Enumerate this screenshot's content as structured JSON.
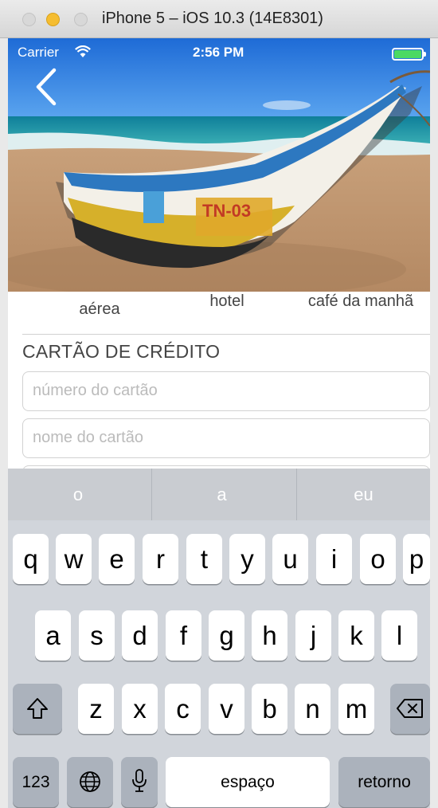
{
  "window": {
    "title": "iPhone 5 – iOS 10.3 (14E8301)"
  },
  "status_bar": {
    "carrier": "Carrier",
    "time": "2:56 PM",
    "battery_color": "#4cd964"
  },
  "nav": {
    "back_icon": "chevron-left-icon"
  },
  "hero": {
    "icon": "beach-boat-photo",
    "boat_text": "TN-03"
  },
  "features": {
    "items": [
      {
        "label": "aérea"
      },
      {
        "label": "hotel"
      },
      {
        "label": "café da manhã"
      }
    ]
  },
  "payment": {
    "section_title": "CARTÃO DE CRÉDITO",
    "card_number_placeholder": "número do cartão",
    "card_name_placeholder": "nome do cartão"
  },
  "keyboard": {
    "predictions": [
      "o",
      "a",
      "eu"
    ],
    "row1": [
      "q",
      "w",
      "e",
      "r",
      "t",
      "y",
      "u",
      "i",
      "o",
      "p"
    ],
    "row2": [
      "a",
      "s",
      "d",
      "f",
      "g",
      "h",
      "j",
      "k",
      "l"
    ],
    "row3": [
      "z",
      "x",
      "c",
      "v",
      "b",
      "n",
      "m"
    ],
    "shift_icon": "shift-icon",
    "backspace_icon": "backspace-icon",
    "numbers_label": "123",
    "globe_icon": "globe-icon",
    "mic_icon": "microphone-icon",
    "space_label": "espaço",
    "return_label": "retorno",
    "background_color": "#d1d5db"
  }
}
